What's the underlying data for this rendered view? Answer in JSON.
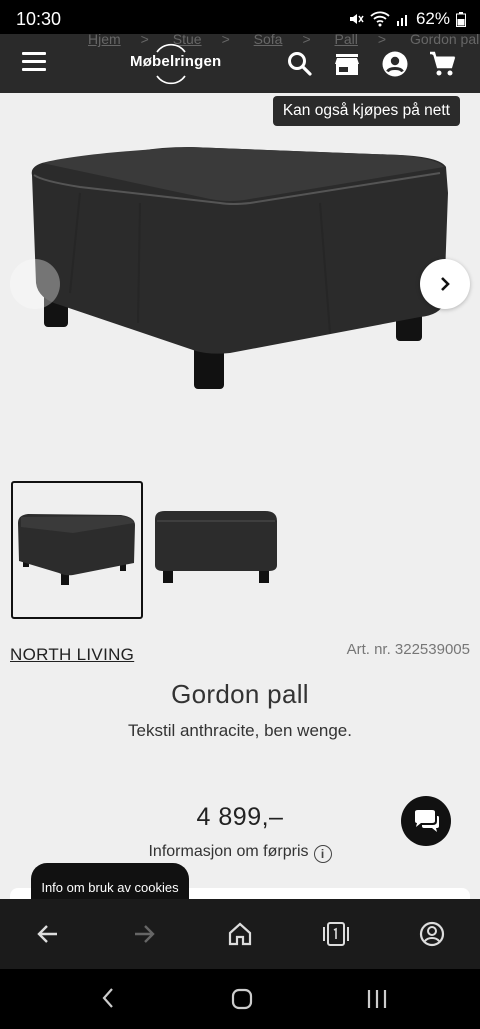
{
  "status": {
    "time": "10:30",
    "battery": "62%"
  },
  "breadcrumbs": [
    "Hjem",
    "Stue",
    "Sofa",
    "Pall",
    "Gordon pall"
  ],
  "header": {
    "logo": "Møbelringen"
  },
  "badge": "Kan også kjøpes på nett",
  "product": {
    "brand": "NORTH LIVING",
    "art_nr": "Art. nr. 322539005",
    "title": "Gordon pall",
    "subtitle": "Tekstil anthracite, ben wenge.",
    "price": "4 899,–",
    "price_info": "Informasjon om førpris"
  },
  "cookie_banner": "Info om bruk av cookies",
  "colors": {
    "header": "#2a2a2a",
    "page_bg": "#efefef",
    "fabric": "#2e2e2e"
  }
}
